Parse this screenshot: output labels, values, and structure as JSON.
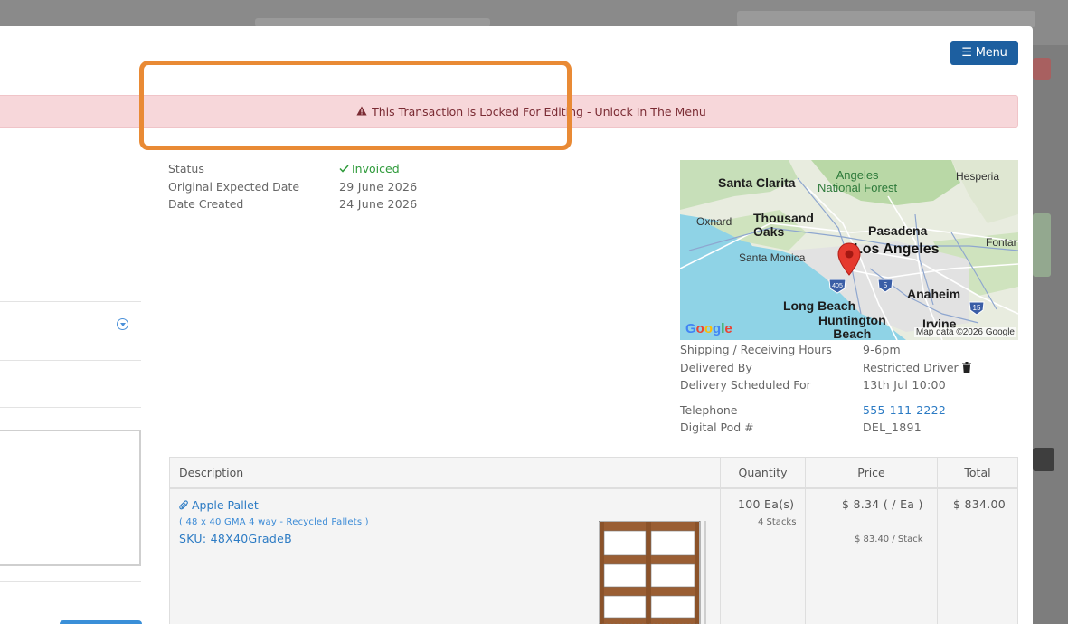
{
  "header": {
    "menu_label": "Menu",
    "menu_icon": "hamburger-icon"
  },
  "banner": {
    "text": "This Transaction Is Locked For Editing - Unlock In The Menu",
    "icon": "warning-triangle-icon"
  },
  "details": {
    "status_label": "Status",
    "status_value": "Invoiced",
    "expected_label": "Original Expected Date",
    "expected_value": "29 June 2026",
    "created_label": "Date Created",
    "created_value": "24 June 2026"
  },
  "map": {
    "labels": {
      "santa_clarita": "Santa Clarita",
      "angeles_forest_1": "Angeles",
      "angeles_forest_2": "National Forest",
      "hesperia": "Hesperia",
      "oxnard": "Oxnard",
      "thousand_oaks_1": "Thousand",
      "thousand_oaks_2": "Oaks",
      "pasadena": "Pasadena",
      "los_angeles": "Los Angeles",
      "fontana": "Fontar",
      "santa_monica": "Santa Monica",
      "anaheim": "Anaheim",
      "long_beach": "Long Beach",
      "huntington_1": "Huntington",
      "huntington_2": "Beach",
      "irvine": "Irvine",
      "shield_405": "405",
      "shield_5": "5",
      "shield_15": "15"
    },
    "google": "Google",
    "attribution": "Map data ©2026 Google"
  },
  "delivery": {
    "hours_label": "Shipping / Receiving Hours",
    "hours_value": "9-6pm",
    "delivered_by_label": "Delivered By",
    "delivered_by_value": "Restricted Driver",
    "scheduled_label": "Delivery Scheduled For",
    "scheduled_value": "13th Jul 10:00",
    "telephone_label": "Telephone",
    "telephone_value": "555-111-2222",
    "pod_label": "Digital Pod #",
    "pod_value": "DEL_1891"
  },
  "table": {
    "headers": {
      "description": "Description",
      "quantity": "Quantity",
      "price": "Price",
      "total": "Total"
    },
    "item": {
      "name": "Apple Pallet",
      "subtitle": "( 48 x 40 GMA 4 way - Recycled Pallets )",
      "sku": "SKU: 48X40GradeB",
      "quantity": "100 Ea(s)",
      "stacks": "4 Stacks",
      "price": "$ 8.34 ( / Ea )",
      "price_per_stack": "$ 83.40 / Stack",
      "total": "$ 834.00"
    }
  },
  "colors": {
    "primary": "#1d5fa0",
    "highlight": "#e98a35",
    "banner_bg": "#f7d7da",
    "banner_text": "#7a2b33",
    "status_green": "#2e9a3a",
    "link_blue": "#2c7bc4"
  }
}
